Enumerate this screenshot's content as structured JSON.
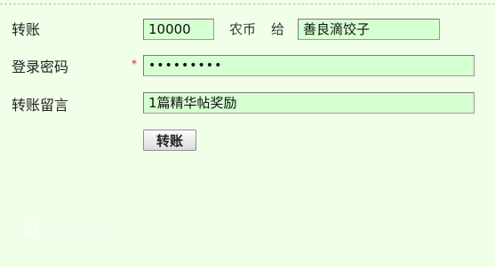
{
  "form": {
    "transfer": {
      "label": "转账",
      "amount_value": "10000",
      "currency_text": "农币",
      "to_text": "给",
      "recipient_value": "善良滴饺子"
    },
    "password": {
      "label": "登录密码",
      "required_mark": "*",
      "value": "•••••••••"
    },
    "message": {
      "label": "转账留言",
      "value": "1篇精华帖奖励"
    },
    "submit_label": "转账"
  },
  "watermark": {
    "text": "农人之家"
  }
}
